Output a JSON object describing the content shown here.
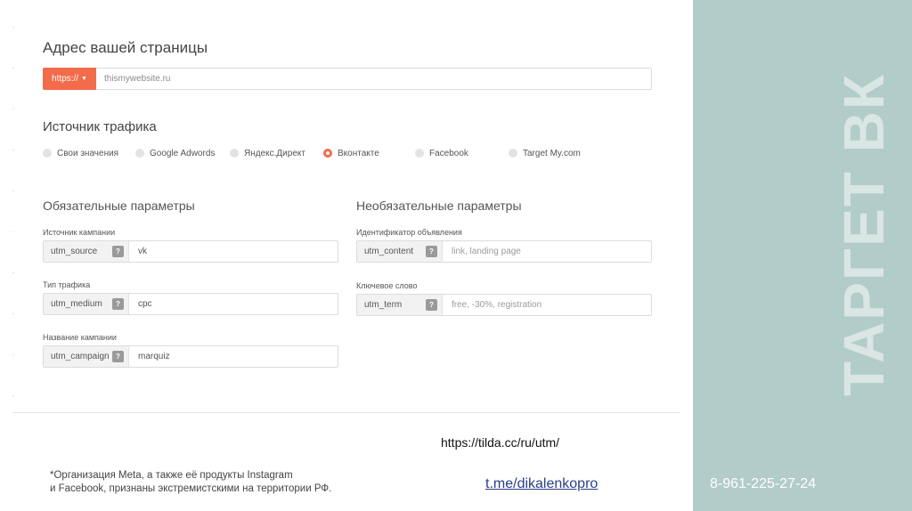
{
  "form": {
    "address_heading": "Адрес вашей страницы",
    "protocol_button": "https://",
    "url_value": "thismywebsite.ru",
    "traffic_heading": "Источник трафика",
    "sources": [
      {
        "label": "Свои значения",
        "checked": false
      },
      {
        "label": "Google Adwords",
        "checked": false
      },
      {
        "label": "Яндекс.Директ",
        "checked": false
      },
      {
        "label": "Вконтакте",
        "checked": true
      },
      {
        "label": "Facebook",
        "checked": false
      },
      {
        "label": "Target My.com",
        "checked": false
      }
    ],
    "required_heading": "Обязательные параметры",
    "optional_heading": "Необязательные параметры",
    "required": [
      {
        "label": "Источник кампании",
        "key": "utm_source",
        "value": "vk"
      },
      {
        "label": "Тип трафика",
        "key": "utm_medium",
        "value": "cpc"
      },
      {
        "label": "Название кампании",
        "key": "utm_campaign",
        "value": "marquiz"
      }
    ],
    "optional": [
      {
        "label": "Идентификатор объявления",
        "key": "utm_content",
        "placeholder": "link, landing page"
      },
      {
        "label": "Ключевое слово",
        "key": "utm_term",
        "placeholder": "free, -30%, registration"
      }
    ],
    "help_glyph": "?"
  },
  "slide": {
    "vertical_title": "ТАРГЕТ ВК",
    "source_url": "https://tilda.cc/ru/utm/",
    "disclaimer_line1": "*Организация Meta, а также её продукты Instagram",
    "disclaimer_line2": "и Facebook, признаны экстремистскими на территории РФ.",
    "telegram_link": "t.me/dikalenkopro",
    "phone": "8-961-225-27-24"
  },
  "colors": {
    "accent": "#f26b4a",
    "sidebar": "#b2ccc9",
    "link": "#2a3d8a"
  }
}
